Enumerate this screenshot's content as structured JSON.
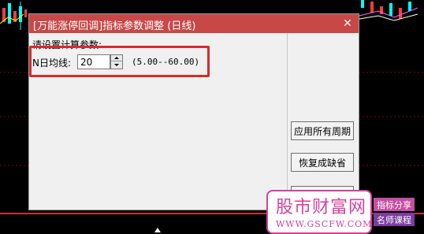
{
  "dialog": {
    "title": "[万能涨停回调]指标参数调整 (日线)",
    "close_glyph": "✕",
    "prompt": "请设置计算参数:",
    "param": {
      "label": "N日均线:",
      "value": "20",
      "range": "(5.00--60.00)"
    },
    "buttons": {
      "apply_all": "应用所有周期",
      "restore_default": "恢复成缺省"
    }
  },
  "watermark": {
    "title": "股市财富网",
    "url": "WWW.GSCFW.COM",
    "tag1": "指标分享",
    "tag2": "名师课程"
  },
  "colors": {
    "titlebar": "#c84848",
    "highlight": "#d42b2b",
    "watermark": "#d9409b"
  }
}
